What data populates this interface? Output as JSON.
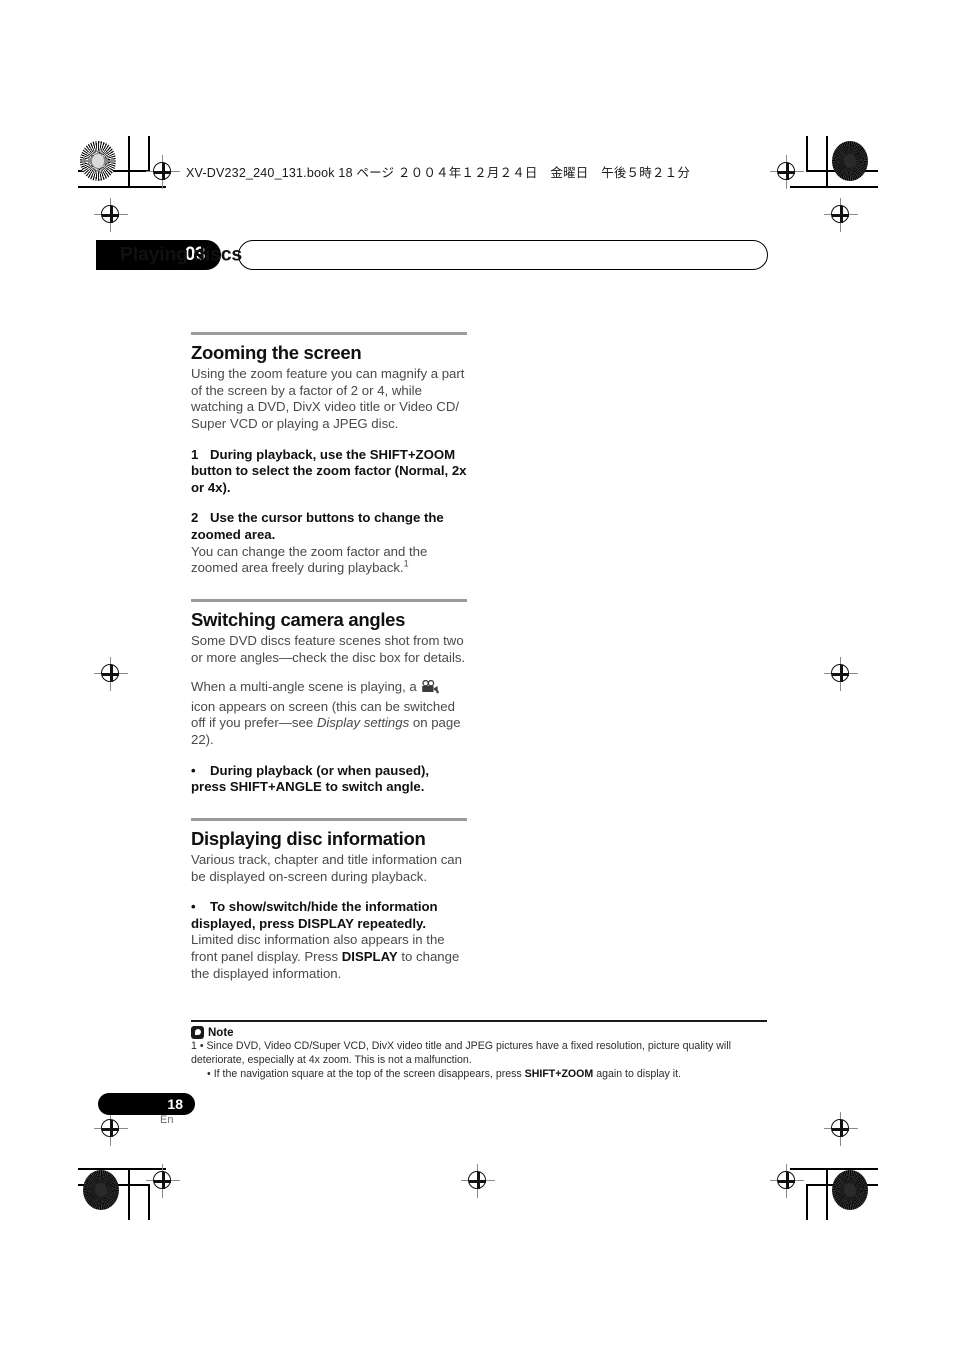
{
  "print_header": {
    "text": "XV-DV232_240_131.book 18 ページ ２００４年１２月２４日　金曜日　午後５時２１分"
  },
  "chapter": {
    "number": "03",
    "title": "Playing discs"
  },
  "sections": [
    {
      "heading": "Zooming the screen",
      "intro": "Using the zoom feature you can magnify a part of the screen by a factor of 2 or 4, while watching a DVD, DivX video title or Video CD/ Super VCD or playing a JPEG disc.",
      "step1_num": "1",
      "step1_text": "During playback, use the SHIFT+ZOOM button to select the zoom factor (Normal, 2x or 4x).",
      "step2_num": "2",
      "step2_text": "Use the cursor buttons to change the zoomed area.",
      "step2_body_a": "You can change the zoom factor and the zoomed area freely during playback.",
      "step2_footnote": "1"
    },
    {
      "heading": "Switching camera angles",
      "intro": "Some DVD discs feature scenes shot from two or more angles—check the disc box for details.",
      "para2_a": "When a multi-angle scene is playing, a ",
      "para2_b": " icon appears on screen (this can be switched off if you prefer—see ",
      "para2_italic": "Display settings",
      "para2_c": " on page 22).",
      "bullet": "•",
      "bullet_text": "During playback (or when paused), press SHIFT+ANGLE to switch angle."
    },
    {
      "heading": "Displaying disc information",
      "intro": "Various track, chapter and title information can be displayed on-screen during playback.",
      "bullet": "•",
      "bullet_text": "To show/switch/hide the information displayed, press DISPLAY repeatedly.",
      "after_a": "Limited disc information also appears in the front panel display. Press ",
      "after_bold": "DISPLAY",
      "after_b": " to change the displayed information."
    }
  ],
  "note": {
    "label": "Note",
    "line1": "1 • Since DVD, Video CD/Super VCD, DivX video title and JPEG pictures have a fixed resolution, picture quality will deteriorate, especially at 4x zoom. This is not a malfunction.",
    "line2_bullet": "•",
    "line2_a": "If the navigation square at the top of the screen disappears, press ",
    "line2_bold": "SHIFT+ZOOM",
    "line2_b": " again to display it."
  },
  "footer": {
    "page_number": "18",
    "language": "En"
  }
}
